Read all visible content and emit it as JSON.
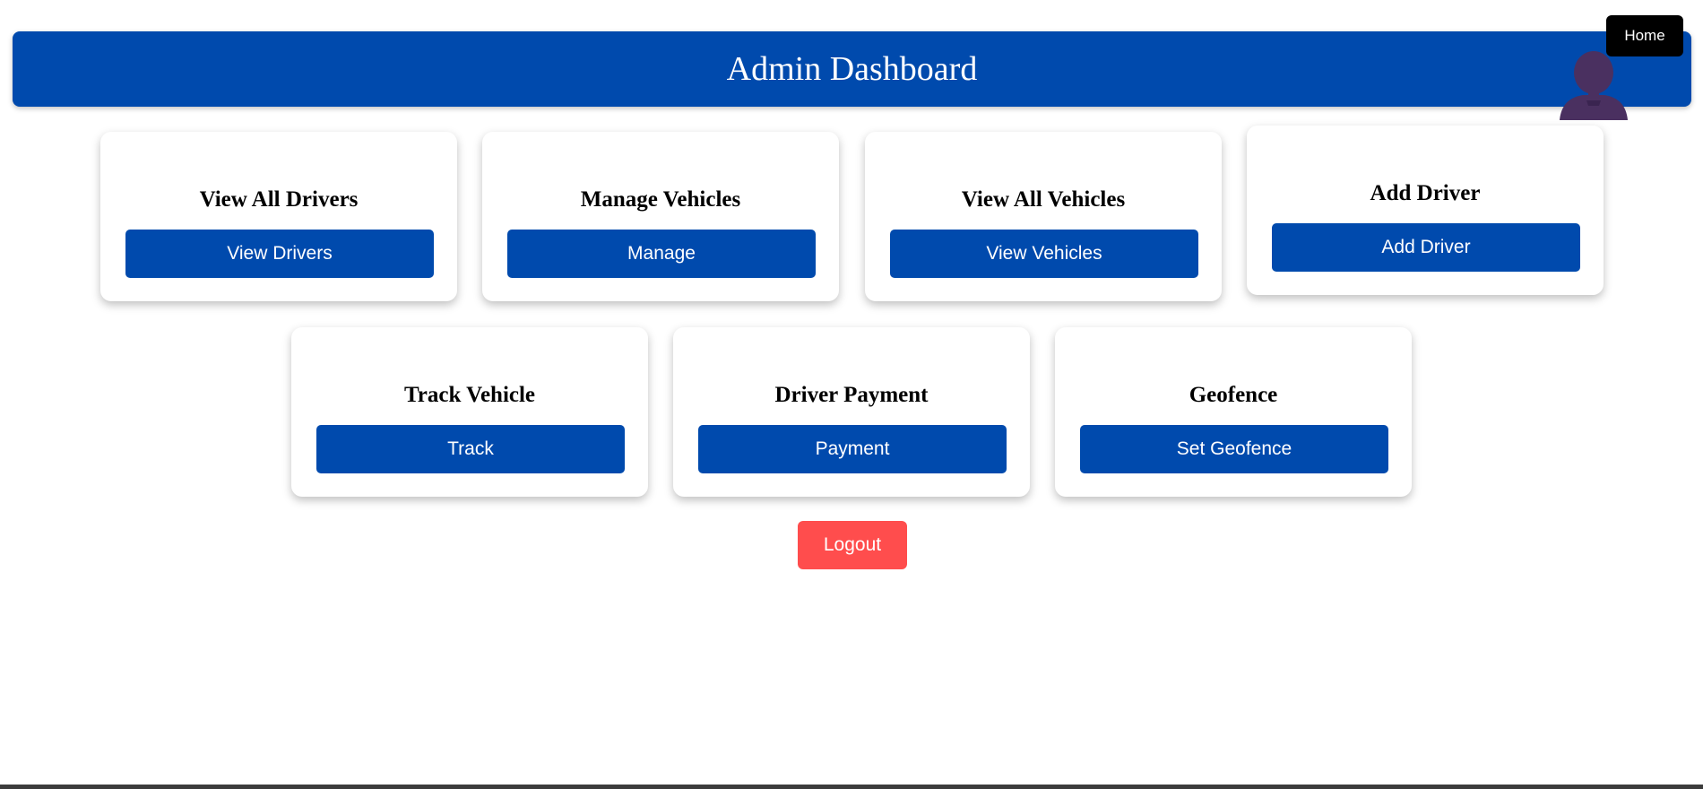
{
  "header": {
    "title": "Admin Dashboard",
    "home_label": "Home",
    "avatar_icon": "user-avatar-icon",
    "background": "#004aad"
  },
  "cards": [
    {
      "title": "View All Drivers",
      "button": "View Drivers"
    },
    {
      "title": "Manage Vehicles",
      "button": "Manage"
    },
    {
      "title": "View All Vehicles",
      "button": "View Vehicles"
    },
    {
      "title": "Add Driver",
      "button": "Add Driver"
    },
    {
      "title": "Track Vehicle",
      "button": "Track"
    },
    {
      "title": "Driver Payment",
      "button": "Payment"
    },
    {
      "title": "Geofence",
      "button": "Set Geofence"
    }
  ],
  "logout": {
    "label": "Logout",
    "color": "#ff4d4d"
  },
  "colors": {
    "primary": "#004aad",
    "home_button": "#000000",
    "avatar": "#4a3060"
  }
}
